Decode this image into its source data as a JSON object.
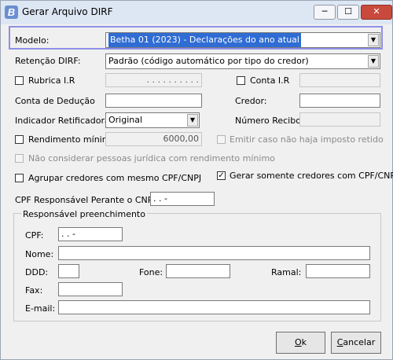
{
  "window": {
    "title": "Gerar Arquivo DIRF",
    "app_icon_letter": "B"
  },
  "titlebar_buttons": {
    "minimize": "─",
    "maximize": "☐",
    "close": "✕"
  },
  "modelo": {
    "label": "Modelo:",
    "value": "Betha 01 (2023) - Declarações do ano atual"
  },
  "retencao": {
    "label": "Retenção DIRF:",
    "value": "Padrão (código automático por tipo do credor)"
  },
  "rubrica": {
    "label": "Rubrica I.R",
    "value": ". . . . . . . . . ."
  },
  "conta_ir": {
    "label": "Conta I.R",
    "value": ""
  },
  "conta_deducao": {
    "label": "Conta de Dedução",
    "value": ""
  },
  "credor": {
    "label": "Credor:",
    "value": ""
  },
  "indicador": {
    "label": "Indicador Retificadora:",
    "value": "Original"
  },
  "numero_recibo": {
    "label": "Número Recibo:",
    "value": ""
  },
  "rendimento": {
    "label": "Rendimento mínimo",
    "value": "6000,00"
  },
  "emitir_caso": {
    "label": "Emitir caso não haja imposto retido"
  },
  "nao_considerar": {
    "label": "Não considerar pessoas jurídica com rendimento mínimo"
  },
  "agrupar": {
    "label": "Agrupar credores com mesmo CPF/CNPJ"
  },
  "gerar_somente": {
    "label": "Gerar somente credores com CPF/CNPJ",
    "check": "✓"
  },
  "cpf_responsavel": {
    "label": "CPF Responsável Perante o CNPJ:",
    "value": ".   .   -"
  },
  "responsavel": {
    "title": "Responsável preenchimento",
    "cpf_label": "CPF:",
    "cpf_value": ".   .   -",
    "nome_label": "Nome:",
    "ddd_label": "DDD:",
    "fone_label": "Fone:",
    "ramal_label": "Ramal:",
    "fax_label": "Fax:",
    "email_label": "E-mail:"
  },
  "buttons": {
    "ok_ul": "O",
    "ok_rest": "k",
    "cancel_ul": "C",
    "cancel_rest": "ancelar"
  }
}
